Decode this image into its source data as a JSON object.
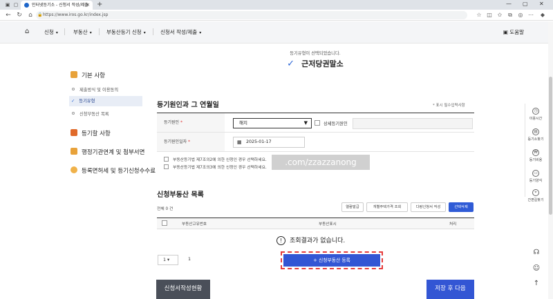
{
  "browser": {
    "tab_title": "인터넷등기소 - 신청서 작성/제출",
    "url": "https://www.iros.go.kr/index.jsp",
    "new_tab_symbol": "+",
    "close_symbol": "×"
  },
  "nav": {
    "menus": [
      {
        "label": "신청"
      },
      {
        "label": "부동산"
      },
      {
        "label": "부동산등기 신청"
      },
      {
        "label": "신청서 작성/제출"
      }
    ],
    "help_label": "도움말"
  },
  "sidebar": {
    "sections": [
      {
        "label": "기본 사항",
        "color": "#e8a23a"
      },
      {
        "label": "등기할 사항",
        "color": "#e06a2a"
      },
      {
        "label": "행정기관연계 및 첨부서면",
        "color": "#e8a23a"
      },
      {
        "label": "등록면허세 및 등기신청수수료",
        "color": "#f0b24a"
      }
    ],
    "subitems": [
      {
        "label": "제출방식 및 이용동의"
      },
      {
        "label": "등기유형"
      },
      {
        "label": "신청부동산 목록"
      }
    ]
  },
  "main": {
    "selected_note": "등기유형이 선택되었습니다.",
    "selected_type": "근저당권말소",
    "section1_title": "등기원인과 그 연월일",
    "required_note": "* 표시 필수입력사항",
    "cause_label": "등기원인",
    "cause_value": "해지",
    "detail_cause_label": "상세등기원인",
    "date_label": "등기원인일자",
    "date_value": "2025-01-17",
    "required_mark": "*",
    "law_options": [
      "부동산등기법 제7조의2에 의한 신청인 경우 선택하세요.",
      "부동산등기법 제7조의3에 의한 신청인 경우 선택하세요."
    ],
    "watermark": ".com/zzazzanong",
    "section2_title": "신청부동산 목록",
    "total_label": "전체 0 건",
    "toolbar_buttons": [
      "열람발급",
      "개별주택가격 조회",
      "다량신청서 작성",
      "선택삭제"
    ],
    "grid_columns": [
      "부동산고유번호",
      "부동산표시",
      "처리"
    ],
    "empty_message": "조회결과가 없습니다.",
    "empty_icon": "!",
    "page_size": "1",
    "page_number": "1",
    "register_button": "+ 신청부동산 등록",
    "status_button": "신청서작성현황",
    "save_button": "저장 후 다음"
  },
  "quick_menu": [
    "이용시간",
    "등기소찾기",
    "등기비용",
    "등기양식",
    "간편길찾기"
  ],
  "colors": {
    "primary": "#3356d4",
    "highlight": "#e53a3a"
  }
}
